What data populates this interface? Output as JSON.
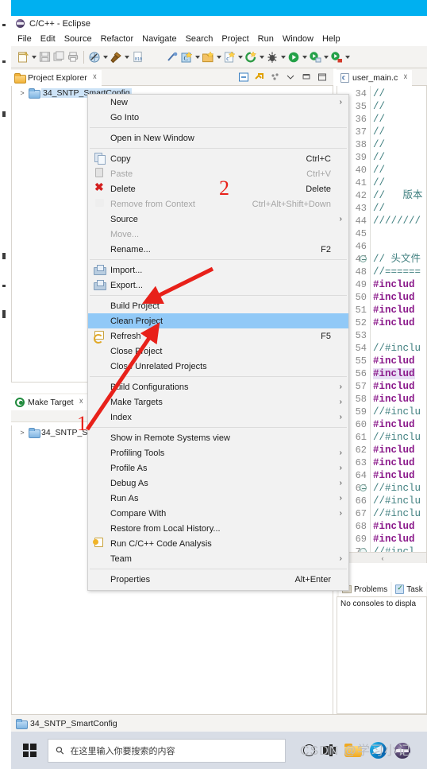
{
  "window": {
    "title": "C/C++ - Eclipse",
    "app_icon": "eclipse-icon"
  },
  "menubar": {
    "items": [
      "File",
      "Edit",
      "Source",
      "Refactor",
      "Navigate",
      "Search",
      "Project",
      "Run",
      "Window",
      "Help"
    ]
  },
  "toolbar": {
    "buttons": [
      "new-file-icon",
      "dropdown-arrow",
      "save-icon",
      "save-all-icon",
      "print-icon",
      "separator",
      "build-all-icon",
      "dropdown-arrow",
      "build-hammer-icon",
      "dropdown-arrow",
      "binary-icon",
      "gap",
      "skip-breakpoints-icon",
      "new-c-project-icon",
      "dropdown-arrow",
      "new-folder-icon",
      "dropdown-arrow",
      "new-class-icon",
      "dropdown-arrow",
      "open-type-icon",
      "dropdown-arrow",
      "debug-icon",
      "dropdown-arrow",
      "run-icon",
      "dropdown-arrow",
      "run-config-icon",
      "dropdown-arrow",
      "external-tools-icon",
      "dropdown-arrow"
    ]
  },
  "project_explorer": {
    "tab_label": "Project Explorer",
    "tab_icon": "folder-icon",
    "close_icon": "close-icon",
    "tools": [
      "collapse-all-icon",
      "link-editor-icon",
      "view-menu-icon",
      "minimize-icon",
      "maximize-icon"
    ],
    "tree": [
      {
        "label": "34_SNTP_SmartConfig",
        "expander": ">",
        "icon": "project-folder-icon",
        "selected": true
      }
    ]
  },
  "make_target": {
    "tab_label": "Make Target",
    "tab_icon": "make-target-icon",
    "close_icon": "close-icon",
    "tree": [
      {
        "label": "34_SNTP_Sm",
        "expander": ">",
        "icon": "project-folder-icon"
      }
    ]
  },
  "editor": {
    "tab_label": "user_main.c",
    "tab_icon": "c-source-file-icon",
    "close_icon": "close-icon",
    "scroll_left_arrow": "‹",
    "lines": [
      {
        "n": "34",
        "text": "//",
        "kind": "comment",
        "fold": false
      },
      {
        "n": "35",
        "text": "//",
        "kind": "comment",
        "fold": false
      },
      {
        "n": "36",
        "text": "//",
        "kind": "comment",
        "fold": false
      },
      {
        "n": "37",
        "text": "//",
        "kind": "comment",
        "fold": false
      },
      {
        "n": "38",
        "text": "//",
        "kind": "comment",
        "fold": false
      },
      {
        "n": "39",
        "text": "//",
        "kind": "comment",
        "fold": false
      },
      {
        "n": "40",
        "text": "//",
        "kind": "comment",
        "fold": false
      },
      {
        "n": "41",
        "text": "//",
        "kind": "comment",
        "fold": false
      },
      {
        "n": "42",
        "text": "//   版本",
        "kind": "comment",
        "fold": false
      },
      {
        "n": "43",
        "text": "//",
        "kind": "comment",
        "fold": false
      },
      {
        "n": "44",
        "text": "////////",
        "kind": "comment",
        "fold": false
      },
      {
        "n": "45",
        "text": "",
        "kind": "plain",
        "fold": false
      },
      {
        "n": "46",
        "text": "",
        "kind": "plain",
        "fold": false
      },
      {
        "n": "47",
        "text": "// 头文件",
        "kind": "comment",
        "fold": true
      },
      {
        "n": "48",
        "text": "//======",
        "kind": "comment",
        "fold": false
      },
      {
        "n": "49",
        "text": "#includ",
        "kind": "pre",
        "fold": false
      },
      {
        "n": "50",
        "text": "#includ",
        "kind": "pre",
        "fold": false
      },
      {
        "n": "51",
        "text": "#includ",
        "kind": "pre",
        "fold": false
      },
      {
        "n": "52",
        "text": "#includ",
        "kind": "pre",
        "fold": false
      },
      {
        "n": "53",
        "text": "",
        "kind": "plain",
        "fold": false
      },
      {
        "n": "54",
        "text": "//#inclu",
        "kind": "comment",
        "fold": false
      },
      {
        "n": "55",
        "text": "#includ",
        "kind": "pre",
        "fold": false
      },
      {
        "n": "56",
        "text": "#includ",
        "kind": "pre-hl",
        "fold": false
      },
      {
        "n": "57",
        "text": "#includ",
        "kind": "pre",
        "fold": false
      },
      {
        "n": "58",
        "text": "#includ",
        "kind": "pre",
        "fold": false
      },
      {
        "n": "59",
        "text": "//#inclu",
        "kind": "comment",
        "fold": false
      },
      {
        "n": "60",
        "text": "#includ",
        "kind": "pre",
        "fold": false
      },
      {
        "n": "61",
        "text": "//#inclu",
        "kind": "comment",
        "fold": false
      },
      {
        "n": "62",
        "text": "#includ",
        "kind": "pre",
        "fold": false
      },
      {
        "n": "63",
        "text": "#includ",
        "kind": "pre",
        "fold": false
      },
      {
        "n": "64",
        "text": "#includ",
        "kind": "pre",
        "fold": false
      },
      {
        "n": "65",
        "text": "//#inclu",
        "kind": "comment",
        "fold": true
      },
      {
        "n": "66",
        "text": "//#inclu",
        "kind": "comment",
        "fold": false
      },
      {
        "n": "67",
        "text": "//#inclu",
        "kind": "comment",
        "fold": false
      },
      {
        "n": "68",
        "text": "#includ",
        "kind": "pre",
        "fold": false
      },
      {
        "n": "69",
        "text": "#includ",
        "kind": "pre",
        "fold": false
      },
      {
        "n": "70",
        "text": "//#incl",
        "kind": "comment",
        "fold": true
      }
    ]
  },
  "console": {
    "tabs": [
      {
        "label": "Problems",
        "icon": "problems-icon"
      },
      {
        "label": "Task",
        "icon": "tasks-icon"
      }
    ],
    "message": "No consoles to displa"
  },
  "statusbar": {
    "icon": "project-folder-icon",
    "text": "34_SNTP_SmartConfig"
  },
  "context_menu": {
    "items": [
      {
        "label": "New",
        "submenu": true,
        "icon": "",
        "shortcut": "",
        "disabled": false
      },
      {
        "label": "Go Into",
        "submenu": false,
        "icon": "",
        "shortcut": "",
        "disabled": false
      },
      {
        "sep": true
      },
      {
        "label": "Open in New Window",
        "submenu": false,
        "icon": "",
        "shortcut": "",
        "disabled": false
      },
      {
        "sep": true
      },
      {
        "label": "Copy",
        "submenu": false,
        "icon": "copy-icon",
        "shortcut": "Ctrl+C",
        "disabled": false
      },
      {
        "label": "Paste",
        "submenu": false,
        "icon": "paste-icon",
        "shortcut": "Ctrl+V",
        "disabled": true
      },
      {
        "label": "Delete",
        "submenu": false,
        "icon": "delete-icon",
        "shortcut": "Delete",
        "disabled": false
      },
      {
        "label": "Remove from Context",
        "submenu": false,
        "icon": "remove-context-icon",
        "shortcut": "Ctrl+Alt+Shift+Down",
        "disabled": true
      },
      {
        "label": "Source",
        "submenu": true,
        "icon": "",
        "shortcut": "",
        "disabled": false
      },
      {
        "label": "Move...",
        "submenu": false,
        "icon": "",
        "shortcut": "",
        "disabled": true
      },
      {
        "label": "Rename...",
        "submenu": false,
        "icon": "",
        "shortcut": "F2",
        "disabled": false
      },
      {
        "sep": true
      },
      {
        "label": "Import...",
        "submenu": false,
        "icon": "import-icon",
        "shortcut": "",
        "disabled": false
      },
      {
        "label": "Export...",
        "submenu": false,
        "icon": "export-icon",
        "shortcut": "",
        "disabled": false
      },
      {
        "sep": true
      },
      {
        "label": "Build Project",
        "submenu": false,
        "icon": "",
        "shortcut": "",
        "disabled": false
      },
      {
        "label": "Clean Project",
        "submenu": false,
        "icon": "",
        "shortcut": "",
        "disabled": false,
        "selected": true
      },
      {
        "label": "Refresh",
        "submenu": false,
        "icon": "refresh-icon",
        "shortcut": "F5",
        "disabled": false
      },
      {
        "label": "Close Project",
        "submenu": false,
        "icon": "",
        "shortcut": "",
        "disabled": false
      },
      {
        "label": "Close Unrelated Projects",
        "submenu": false,
        "icon": "",
        "shortcut": "",
        "disabled": false
      },
      {
        "sep": true
      },
      {
        "label": "Build Configurations",
        "submenu": true,
        "icon": "",
        "shortcut": "",
        "disabled": false
      },
      {
        "label": "Make Targets",
        "submenu": true,
        "icon": "",
        "shortcut": "",
        "disabled": false
      },
      {
        "label": "Index",
        "submenu": true,
        "icon": "",
        "shortcut": "",
        "disabled": false
      },
      {
        "sep": true
      },
      {
        "label": "Show in Remote Systems view",
        "submenu": false,
        "icon": "",
        "shortcut": "",
        "disabled": false
      },
      {
        "label": "Profiling Tools",
        "submenu": true,
        "icon": "",
        "shortcut": "",
        "disabled": false
      },
      {
        "label": "Profile As",
        "submenu": true,
        "icon": "",
        "shortcut": "",
        "disabled": false
      },
      {
        "label": "Debug As",
        "submenu": true,
        "icon": "",
        "shortcut": "",
        "disabled": false
      },
      {
        "label": "Run As",
        "submenu": true,
        "icon": "",
        "shortcut": "",
        "disabled": false
      },
      {
        "label": "Compare With",
        "submenu": true,
        "icon": "",
        "shortcut": "",
        "disabled": false
      },
      {
        "label": "Restore from Local History...",
        "submenu": false,
        "icon": "",
        "shortcut": "",
        "disabled": false
      },
      {
        "label": "Run C/C++ Code Analysis",
        "submenu": false,
        "icon": "code-analysis-icon",
        "shortcut": "",
        "disabled": false
      },
      {
        "label": "Team",
        "submenu": true,
        "icon": "",
        "shortcut": "",
        "disabled": false
      },
      {
        "sep": true
      },
      {
        "label": "Properties",
        "submenu": false,
        "icon": "",
        "shortcut": "Alt+Enter",
        "disabled": false
      }
    ]
  },
  "annotations": {
    "marker_1": "1",
    "marker_2": "2",
    "color": "#e8211a"
  },
  "taskbar": {
    "start_icon": "windows-start-icon",
    "search_placeholder": "在这里输入你要搜索的内容",
    "search_icon": "search-icon",
    "icons": [
      "cortana-icon",
      "task-view-icon",
      "file-explorer-icon",
      "edge-icon",
      "eclipse-icon"
    ]
  },
  "watermark": {
    "text": "CSDN @学习小记"
  },
  "colors": {
    "accent_blue": "#00b0f0",
    "menu_highlight": "#91c9f7",
    "tree_selection": "#cde3f7",
    "annotation_red": "#e8211a",
    "comment_green": "#3f7f7f",
    "preprocessor_purple": "#8b1a8b"
  }
}
